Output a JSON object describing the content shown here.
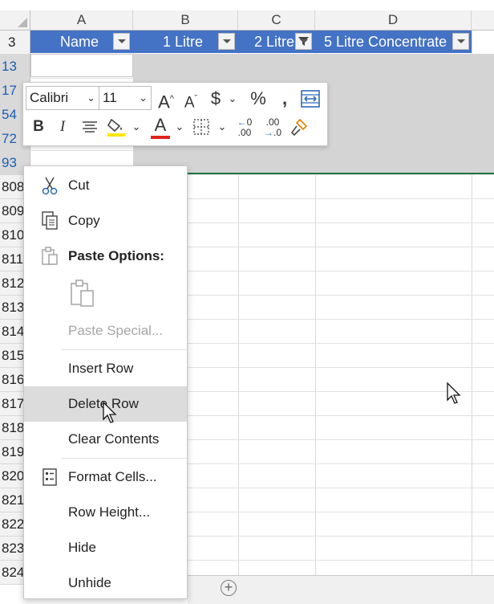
{
  "columns": {
    "a": "A",
    "b": "B",
    "c": "C",
    "d": "D"
  },
  "rows": [
    {
      "label": "3",
      "selected": false
    },
    {
      "label": "13",
      "selected": true
    },
    {
      "label": "17",
      "selected": true
    },
    {
      "label": "54",
      "selected": true
    },
    {
      "label": "72",
      "selected": true
    },
    {
      "label": "93",
      "selected": true
    },
    {
      "label": "808",
      "selected": false
    },
    {
      "label": "809",
      "selected": false
    },
    {
      "label": "810",
      "selected": false
    },
    {
      "label": "811",
      "selected": false
    },
    {
      "label": "812",
      "selected": false
    },
    {
      "label": "813",
      "selected": false
    },
    {
      "label": "814",
      "selected": false
    },
    {
      "label": "815",
      "selected": false
    },
    {
      "label": "816",
      "selected": false
    },
    {
      "label": "817",
      "selected": false
    },
    {
      "label": "818",
      "selected": false
    },
    {
      "label": "819",
      "selected": false
    },
    {
      "label": "820",
      "selected": false
    },
    {
      "label": "821",
      "selected": false
    },
    {
      "label": "822",
      "selected": false
    },
    {
      "label": "823",
      "selected": false
    },
    {
      "label": "824",
      "selected": false
    }
  ],
  "table_header": {
    "name": "Name",
    "one_litre": "1 Litre",
    "two_litre": "2 Litre",
    "five_litre": "5 Litre Concentrate"
  },
  "mini_toolbar": {
    "font_name": "Calibri",
    "font_size": "11"
  },
  "context_menu": {
    "cut": "Cut",
    "copy": "Copy",
    "paste_options": "Paste Options:",
    "paste_special": "Paste Special...",
    "insert_row": "Insert Row",
    "delete_row": "Delete Row",
    "clear_contents": "Clear Contents",
    "format_cells": "Format Cells...",
    "row_height": "Row Height...",
    "hide": "Hide",
    "unhide": "Unhide"
  },
  "sheet_tabs": {
    "add_sheet": "+"
  },
  "colors": {
    "table_header_bg": "#4472c4",
    "selection_border": "#217346",
    "selected_row_header_text": "#1a5fb4",
    "font_color_bar": "#e0221c",
    "fill_color_bar": "#ffe600"
  }
}
